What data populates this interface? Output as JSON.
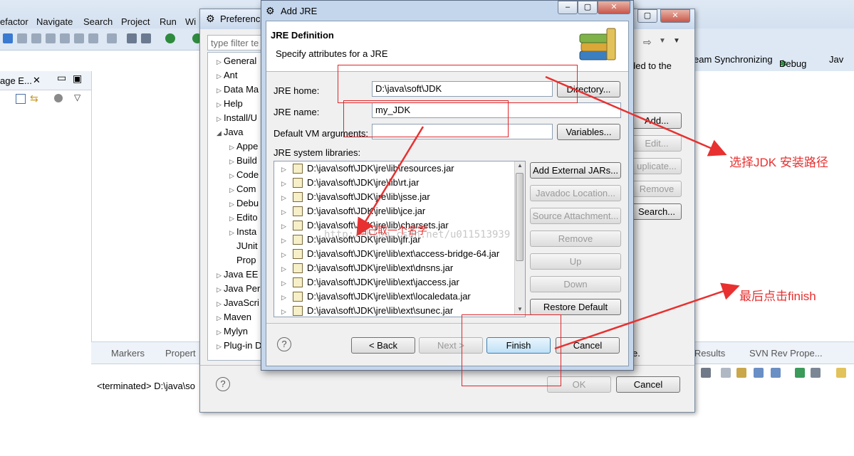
{
  "eclipse": {
    "menu": [
      "efactor",
      "Navigate",
      "Search",
      "Project",
      "Run",
      "Wi"
    ],
    "left_view_tab": "age E...",
    "perspective_items": [
      "eam Synchronizing",
      "Debug",
      "Jav"
    ],
    "bottom_tabs": [
      "Markers",
      "Propert"
    ],
    "bottom_right_tabs": [
      "e Results",
      "SVN Rev Prope..."
    ],
    "console_text": "<terminated> D:\\java\\so"
  },
  "preferences": {
    "title": "Preferenc",
    "filter_placeholder": "type filter te",
    "tree": [
      {
        "label": "General",
        "indent": 0,
        "arrow": "right"
      },
      {
        "label": "Ant",
        "indent": 0,
        "arrow": "right"
      },
      {
        "label": "Data Ma",
        "indent": 0,
        "arrow": "right"
      },
      {
        "label": "Help",
        "indent": 0,
        "arrow": "right"
      },
      {
        "label": "Install/U",
        "indent": 0,
        "arrow": "right"
      },
      {
        "label": "Java",
        "indent": 0,
        "arrow": "down"
      },
      {
        "label": "Appe",
        "indent": 1,
        "arrow": "right"
      },
      {
        "label": "Build",
        "indent": 1,
        "arrow": "right"
      },
      {
        "label": "Code",
        "indent": 1,
        "arrow": "right"
      },
      {
        "label": "Com",
        "indent": 1,
        "arrow": "right"
      },
      {
        "label": "Debu",
        "indent": 1,
        "arrow": "right"
      },
      {
        "label": "Edito",
        "indent": 1,
        "arrow": "right"
      },
      {
        "label": "Insta",
        "indent": 1,
        "arrow": "right"
      },
      {
        "label": "JUnit",
        "indent": 1,
        "arrow": ""
      },
      {
        "label": "Prop",
        "indent": 1,
        "arrow": ""
      },
      {
        "label": "Java EE",
        "indent": 0,
        "arrow": "right"
      },
      {
        "label": "Java Per",
        "indent": 0,
        "arrow": "right"
      },
      {
        "label": "JavaScri",
        "indent": 0,
        "arrow": "right"
      },
      {
        "label": "Maven",
        "indent": 0,
        "arrow": "right"
      },
      {
        "label": "Mylyn",
        "indent": 0,
        "arrow": "right"
      },
      {
        "label": "Plug-in D",
        "indent": 0,
        "arrow": "right"
      }
    ],
    "right_text": "ded to the",
    "right_text2": "e.",
    "side_buttons": [
      "Add...",
      "Edit...",
      "uplicate...",
      "Remove",
      "Search..."
    ],
    "ok_label": "OK",
    "cancel_label": "Cancel"
  },
  "add_jre": {
    "title": "Add JRE",
    "header_title": "JRE Definition",
    "header_subtitle": "Specify attributes for a JRE",
    "jre_home_label": "JRE home:",
    "jre_home_value": "D:\\java\\soft\\JDK",
    "directory_button": "Directory...",
    "jre_name_label": "JRE name:",
    "jre_name_value": "my_JDK",
    "vm_args_label": "Default VM arguments:",
    "vm_args_value": "",
    "variables_button": "Variables...",
    "libraries_label": "JRE system libraries:",
    "libraries": [
      "D:\\java\\soft\\JDK\\jre\\lib\\resources.jar",
      "D:\\java\\soft\\JDK\\jre\\lib\\rt.jar",
      "D:\\java\\soft\\JDK\\jre\\lib\\jsse.jar",
      "D:\\java\\soft\\JDK\\jre\\lib\\jce.jar",
      "D:\\java\\soft\\JDK\\jre\\lib\\charsets.jar",
      "D:\\java\\soft\\JDK\\jre\\lib\\jfr.jar",
      "D:\\java\\soft\\JDK\\jre\\lib\\ext\\access-bridge-64.jar",
      "D:\\java\\soft\\JDK\\jre\\lib\\ext\\dnsns.jar",
      "D:\\java\\soft\\JDK\\jre\\lib\\ext\\jaccess.jar",
      "D:\\java\\soft\\JDK\\jre\\lib\\ext\\localedata.jar",
      "D:\\java\\soft\\JDK\\jre\\lib\\ext\\sunec.jar"
    ],
    "lib_buttons": [
      "Add External JARs...",
      "Javadoc Location...",
      "Source Attachment...",
      "Remove",
      "Up",
      "Down",
      "Restore Default"
    ],
    "back_button": "< Back",
    "next_button": "Next >",
    "finish_button": "Finish",
    "cancel_button": "Cancel"
  },
  "annotations": {
    "select_path": "选择JDK 安装路径",
    "name_it": "自己取一个名字",
    "click_finish": "最后点击finish",
    "watermark": "http://blog.csdn.net/u011513939",
    "color": "#e83030"
  }
}
